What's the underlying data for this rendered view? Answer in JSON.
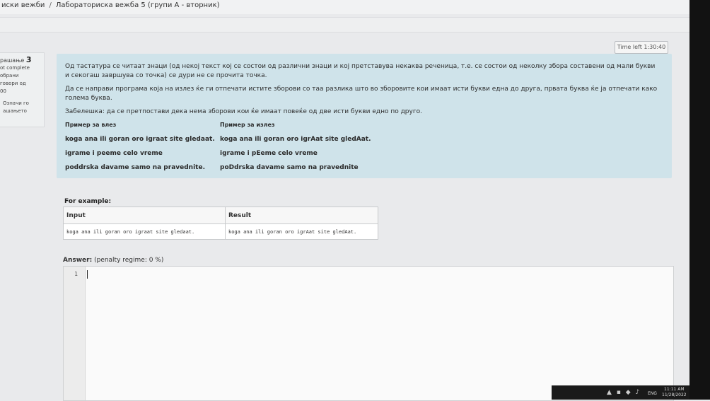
{
  "breadcrumb": {
    "items": [
      "иски вежби",
      "Лабораториска вежба 5 (групи А - вторник)"
    ],
    "separator": "/"
  },
  "timer": {
    "label": "Time left 1:30:40"
  },
  "question_info": {
    "prefix": "рашање",
    "number": "3",
    "status": "ot complete",
    "marks_line1": "обрани",
    "marks_line2": "говори од",
    "marks_line3": "00",
    "flag_line1": "Означи го",
    "flag_line2": "ашањето"
  },
  "question": {
    "p1": "Од тастатура се читаат знаци (од некој текст кој се состои од различни знаци и кој претставува некаква реченица, т.е. се состои од неколку збора составени од мали букви и секогаш завршува со точка) се дури не се прочита точка.",
    "p2": "Да се направи програма која на излез ќе ги отпечати истите зборови со таа разлика што во зборовите кои имаат исти букви една до друга, првата буква ќе ја отпечати како голема буква.",
    "p3": "Забелешка: да се претпостави дека нема зборови кои ќе имаат повеќе од две исти букви едно по друго.",
    "example_headers": [
      "Пример за влез",
      "Пример за излез"
    ],
    "example_rows": [
      [
        "koga ana ili goran oro igraat site gledaat.",
        "koga ana ili goran oro igrAat site gledAat."
      ],
      [
        "igrame i peeme celo vreme",
        "igrame i pEeme celo vreme"
      ],
      [
        "poddrska davame samo na pravednite.",
        "poDdrska davame samo na pravednite"
      ]
    ]
  },
  "for_example": {
    "label": "For example:",
    "headers": [
      "Input",
      "Result"
    ],
    "row": [
      "koga ana ili goran oro igraat site gledaat.",
      "koga ana ili goran oro igrAat site gledAat."
    ]
  },
  "answer": {
    "label": "Answer:",
    "penalty": "(penalty regime: 0 %)",
    "line_number": "1"
  },
  "taskbar": {
    "lang": "ENG",
    "time": "11:11 AM",
    "date": "11/28/2022"
  },
  "colors": {
    "question_bg": "#cfe3ea",
    "page_bg": "#e9eaec"
  }
}
